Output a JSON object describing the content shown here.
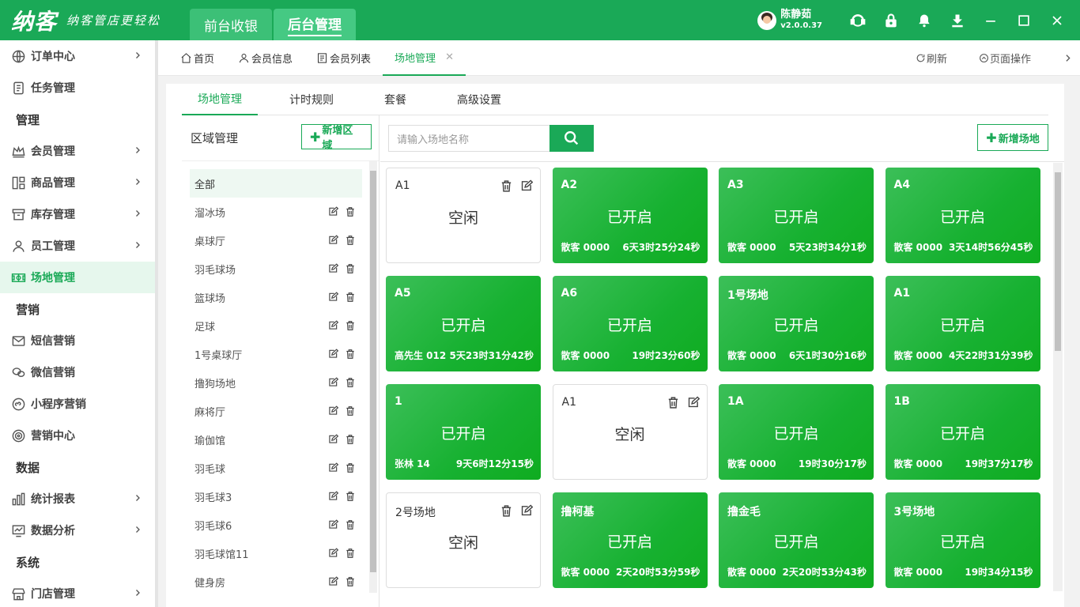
{
  "app": {
    "logo": "纳客",
    "slogan": "纳客管店更轻松",
    "top_tabs": [
      "前台收银",
      "后台管理"
    ],
    "user_name": "陈静茹",
    "version": "v2.0.0.37"
  },
  "sidebar": {
    "items": [
      {
        "type": "item",
        "label": "订单中心",
        "icon": "order-icon",
        "chevron": true
      },
      {
        "type": "item",
        "label": "任务管理",
        "icon": "task-icon",
        "chevron": false
      },
      {
        "type": "group",
        "label": "管理"
      },
      {
        "type": "item",
        "label": "会员管理",
        "icon": "crown-icon",
        "chevron": true
      },
      {
        "type": "item",
        "label": "商品管理",
        "icon": "goods-icon",
        "chevron": true
      },
      {
        "type": "item",
        "label": "库存管理",
        "icon": "inventory-icon",
        "chevron": true
      },
      {
        "type": "item",
        "label": "员工管理",
        "icon": "staff-icon",
        "chevron": true
      },
      {
        "type": "item",
        "label": "场地管理",
        "icon": "venue-icon",
        "chevron": false,
        "active": true
      },
      {
        "type": "group",
        "label": "营销"
      },
      {
        "type": "item",
        "label": "短信营销",
        "icon": "sms-icon",
        "chevron": false
      },
      {
        "type": "item",
        "label": "微信营销",
        "icon": "wechat-icon",
        "chevron": false
      },
      {
        "type": "item",
        "label": "小程序营销",
        "icon": "miniprogram-icon",
        "chevron": false
      },
      {
        "type": "item",
        "label": "营销中心",
        "icon": "target-icon",
        "chevron": false
      },
      {
        "type": "group",
        "label": "数据"
      },
      {
        "type": "item",
        "label": "统计报表",
        "icon": "report-icon",
        "chevron": true
      },
      {
        "type": "item",
        "label": "数据分析",
        "icon": "analysis-icon",
        "chevron": true
      },
      {
        "type": "group",
        "label": "系统"
      },
      {
        "type": "item",
        "label": "门店管理",
        "icon": "store-icon",
        "chevron": true
      }
    ]
  },
  "page_tabs": [
    {
      "label": "首页",
      "icon": "home-icon"
    },
    {
      "label": "会员信息",
      "icon": "user-icon"
    },
    {
      "label": "会员列表",
      "icon": "list-icon"
    },
    {
      "label": "场地管理",
      "icon": "",
      "active": true,
      "closable": true
    }
  ],
  "tab_actions": {
    "refresh": "刷新",
    "page_ops": "页面操作"
  },
  "sub_tabs": [
    "场地管理",
    "计时规则",
    "套餐",
    "高级设置"
  ],
  "areas": {
    "title": "区域管理",
    "add_label": "新增区域",
    "items": [
      "全部",
      "溜冰场",
      "桌球厅",
      "羽毛球场",
      "篮球场",
      "足球",
      "1号桌球厅",
      "撸狗场地",
      "麻将厅",
      "瑜伽馆",
      "羽毛球",
      "羽毛球3",
      "羽毛球6",
      "羽毛球馆11",
      "健身房"
    ]
  },
  "venues": {
    "search_placeholder": "请输入场地名称",
    "add_label": "新增场地",
    "cards": [
      {
        "name": "A1",
        "status": "空闲",
        "idle": true
      },
      {
        "name": "A2",
        "status": "已开启",
        "guest": "散客 0000",
        "time": "6天3时25分24秒"
      },
      {
        "name": "A3",
        "status": "已开启",
        "guest": "散客 0000",
        "time": "5天23时34分1秒"
      },
      {
        "name": "A4",
        "status": "已开启",
        "guest": "散客 0000",
        "time": "3天14时56分45秒"
      },
      {
        "name": "A5",
        "status": "已开启",
        "guest": "高先生 012",
        "time": "5天23时31分42秒"
      },
      {
        "name": "A6",
        "status": "已开启",
        "guest": "散客 0000",
        "time": "19时23分60秒"
      },
      {
        "name": "1号场地",
        "status": "已开启",
        "guest": "散客 0000",
        "time": "6天1时30分16秒"
      },
      {
        "name": "A1",
        "status": "已开启",
        "guest": "散客 0000",
        "time": "4天22时31分39秒"
      },
      {
        "name": "1",
        "status": "已开启",
        "guest": "张林 14",
        "time": "9天6时12分15秒"
      },
      {
        "name": "A1",
        "status": "空闲",
        "idle": true
      },
      {
        "name": "1A",
        "status": "已开启",
        "guest": "散客 0000",
        "time": "19时30分17秒"
      },
      {
        "name": "1B",
        "status": "已开启",
        "guest": "散客 0000",
        "time": "19时37分17秒"
      },
      {
        "name": "2号场地",
        "status": "空闲",
        "idle": true
      },
      {
        "name": "撸柯基",
        "status": "已开启",
        "guest": "散客 0000",
        "time": "2天20时53分59秒"
      },
      {
        "name": "撸金毛",
        "status": "已开启",
        "guest": "散客 0000",
        "time": "2天20时53分43秒"
      },
      {
        "name": "3号场地",
        "status": "已开启",
        "guest": "散客 0000",
        "time": "19时34分15秒"
      }
    ]
  },
  "colors": {
    "brand": "#1aa957",
    "active_bg": "#e6f7ed"
  }
}
